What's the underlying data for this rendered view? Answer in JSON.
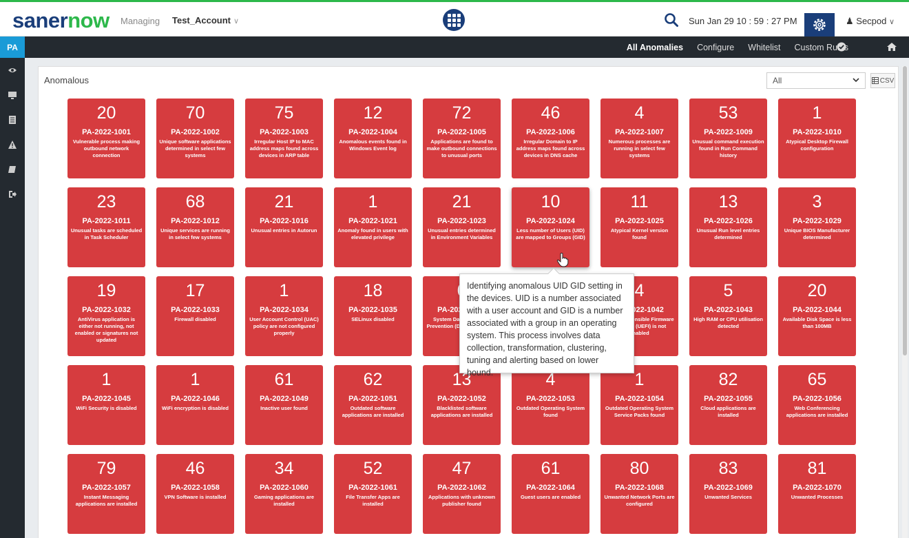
{
  "header": {
    "logo_part1": "saner",
    "logo_part2": "now",
    "managing_label": "Managing",
    "account_name": "Test_Account",
    "datetime": "Sun Jan 29  10 : 59 : 27 PM",
    "user_name": "Secpod"
  },
  "nav": {
    "module": "PA",
    "links": [
      "All Anomalies",
      "Configure",
      "Whitelist",
      "Custom Rules"
    ]
  },
  "sidebar": {
    "icons": [
      "eye-icon",
      "monitor-icon",
      "report-icon",
      "alert-icon",
      "book-icon",
      "logout-icon"
    ]
  },
  "panel": {
    "title": "Anomalous",
    "filter_value": "All",
    "csv_label": "CSV"
  },
  "tiles": [
    {
      "count": "20",
      "code": "PA-2022-1001",
      "desc": "Vulnerable process making outbound network connection"
    },
    {
      "count": "70",
      "code": "PA-2022-1002",
      "desc": "Unique software applications determined in select few systems"
    },
    {
      "count": "75",
      "code": "PA-2022-1003",
      "desc": "Irregular Host IP to MAC address maps found across devices in ARP table"
    },
    {
      "count": "12",
      "code": "PA-2022-1004",
      "desc": "Anomalous events found in Windows Event log"
    },
    {
      "count": "72",
      "code": "PA-2022-1005",
      "desc": "Applications are found to make outbound connections to unusual ports"
    },
    {
      "count": "46",
      "code": "PA-2022-1006",
      "desc": "Irregular Domain to IP address maps found across devices in DNS cache"
    },
    {
      "count": "4",
      "code": "PA-2022-1007",
      "desc": "Numerous processes are running in select few systems"
    },
    {
      "count": "53",
      "code": "PA-2022-1009",
      "desc": "Unusual command execution found in Run Command history"
    },
    {
      "count": "1",
      "code": "PA-2022-1010",
      "desc": "Atypical Desktop Firewall configuration"
    },
    {
      "count": "23",
      "code": "PA-2022-1011",
      "desc": "Unusual tasks are scheduled in Task Scheduler"
    },
    {
      "count": "68",
      "code": "PA-2022-1012",
      "desc": "Unique services are running in select few systems"
    },
    {
      "count": "21",
      "code": "PA-2022-1016",
      "desc": "Unusual entries in Autorun"
    },
    {
      "count": "1",
      "code": "PA-2022-1021",
      "desc": "Anomaly found in users with elevated privilege"
    },
    {
      "count": "21",
      "code": "PA-2022-1023",
      "desc": "Unusual entries determined in Environment Variables"
    },
    {
      "count": "10",
      "code": "PA-2022-1024",
      "desc": "Less number of Users (UID) are mapped to Groups (GID)"
    },
    {
      "count": "11",
      "code": "PA-2022-1025",
      "desc": "Atypical Kernel version found"
    },
    {
      "count": "13",
      "code": "PA-2022-1026",
      "desc": "Unusual Run level entries determined"
    },
    {
      "count": "3",
      "code": "PA-2022-1029",
      "desc": "Unique BIOS Manufacturer determined"
    },
    {
      "count": "19",
      "code": "PA-2022-1032",
      "desc": "AntiVirus application is either not running, not enabled or signatures not updated"
    },
    {
      "count": "17",
      "code": "PA-2022-1033",
      "desc": "Firewall disabled"
    },
    {
      "count": "1",
      "code": "PA-2022-1034",
      "desc": "User Account Control (UAC) policy are not configured properly"
    },
    {
      "count": "18",
      "code": "PA-2022-1035",
      "desc": "SELinux disabled"
    },
    {
      "count": "6",
      "code": "PA-2022-1041",
      "desc": "System Data Execution Prevention (DEP) is disabled"
    },
    {
      "count": "",
      "code": "",
      "desc": ""
    },
    {
      "count": "4",
      "code": "PA-2022-1042",
      "desc": "Unified Extensible Firmware Interface (UEFI) is not enabled"
    },
    {
      "count": "5",
      "code": "PA-2022-1043",
      "desc": "High RAM or CPU utilisation detected"
    },
    {
      "count": "20",
      "code": "PA-2022-1044",
      "desc": "Available Disk Space is less than 100MB"
    },
    {
      "count": "1",
      "code": "PA-2022-1045",
      "desc": "WiFi Security is disabled"
    },
    {
      "count": "1",
      "code": "PA-2022-1046",
      "desc": "WiFi encryption is disabled"
    },
    {
      "count": "61",
      "code": "PA-2022-1049",
      "desc": "Inactive user found"
    },
    {
      "count": "62",
      "code": "PA-2022-1051",
      "desc": "Outdated software applications are installed"
    },
    {
      "count": "13",
      "code": "PA-2022-1052",
      "desc": "Blacklisted software applications are installed"
    },
    {
      "count": "4",
      "code": "PA-2022-1053",
      "desc": "Outdated Operating System found"
    },
    {
      "count": "1",
      "code": "PA-2022-1054",
      "desc": "Outdated Operating System Service Packs found"
    },
    {
      "count": "82",
      "code": "PA-2022-1055",
      "desc": "Cloud applications are installed"
    },
    {
      "count": "65",
      "code": "PA-2022-1056",
      "desc": "Web Conferencing applications are installed"
    },
    {
      "count": "79",
      "code": "PA-2022-1057",
      "desc": "Instant Messaging applications are installed"
    },
    {
      "count": "46",
      "code": "PA-2022-1058",
      "desc": "VPN Software is installed"
    },
    {
      "count": "34",
      "code": "PA-2022-1060",
      "desc": "Gaming applications are installed"
    },
    {
      "count": "52",
      "code": "PA-2022-1061",
      "desc": "File Transfer Apps are installed"
    },
    {
      "count": "47",
      "code": "PA-2022-1062",
      "desc": "Applications with unknown publisher found"
    },
    {
      "count": "61",
      "code": "PA-2022-1064",
      "desc": "Guest users are enabled"
    },
    {
      "count": "80",
      "code": "PA-2022-1068",
      "desc": "Unwanted Network Ports are configured"
    },
    {
      "count": "83",
      "code": "PA-2022-1069",
      "desc": "Unwanted Services"
    },
    {
      "count": "81",
      "code": "PA-2022-1070",
      "desc": "Unwanted Processes"
    }
  ],
  "tooltip": {
    "text": "Identifying anomalous UID GID setting in the devices. UID is a number associated with a user account and GID is a number associated with a group in an operating system. This process involves data collection, transformation, clustering, tuning and alerting based on lower bound."
  },
  "colors": {
    "tile": "#d63c3f",
    "brand_blue": "#1a3e7a",
    "brand_green": "#2db84b",
    "nav_dark": "#242a30",
    "pa_blue": "#1a9bd7"
  }
}
